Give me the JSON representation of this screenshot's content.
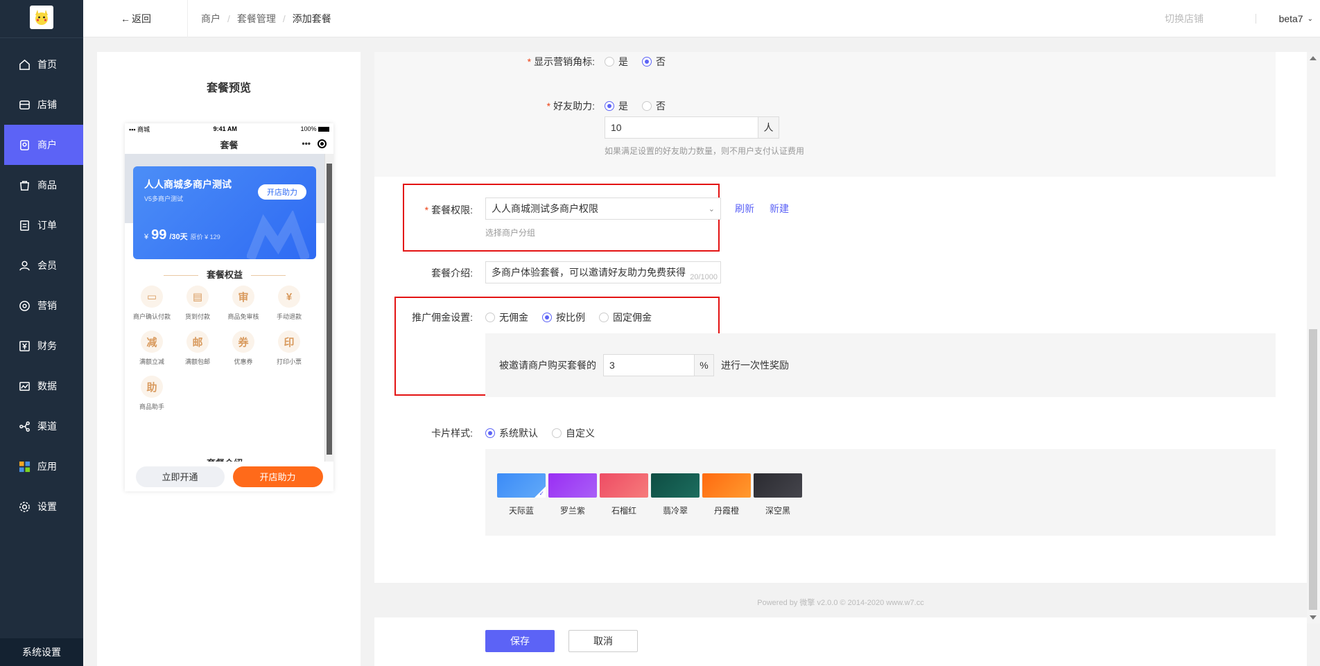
{
  "sidebar": {
    "items": [
      {
        "label": "首页",
        "icon": "home-icon"
      },
      {
        "label": "店铺",
        "icon": "store-icon"
      },
      {
        "label": "商户",
        "icon": "merchant-icon"
      },
      {
        "label": "商品",
        "icon": "goods-icon"
      },
      {
        "label": "订单",
        "icon": "order-icon"
      },
      {
        "label": "会员",
        "icon": "member-icon"
      },
      {
        "label": "营销",
        "icon": "marketing-icon"
      },
      {
        "label": "财务",
        "icon": "finance-icon"
      },
      {
        "label": "数据",
        "icon": "data-icon"
      },
      {
        "label": "渠道",
        "icon": "channel-icon"
      },
      {
        "label": "应用",
        "icon": "apps-icon"
      },
      {
        "label": "设置",
        "icon": "settings-icon"
      }
    ],
    "active_index": 2,
    "system_settings": "系统设置"
  },
  "header": {
    "back": "返回",
    "breadcrumb": [
      "商户",
      "套餐管理",
      "添加套餐"
    ],
    "switch_store": "切换店铺",
    "user": "beta7"
  },
  "preview": {
    "title": "套餐预览",
    "status": {
      "left": "商城",
      "time": "9:41 AM",
      "battery": "100%"
    },
    "nav_title": "套餐",
    "card": {
      "name": "人人商城多商户测试",
      "subtitle": "V5多商户测试",
      "button": "开店助力",
      "currency": "¥",
      "price": "99",
      "period": "/30天",
      "original": "原价 ¥ 129"
    },
    "benefits_title": "套餐权益",
    "benefits": [
      {
        "glyph": "▭",
        "label": "商户确认付款"
      },
      {
        "glyph": "▤",
        "label": "货到付款"
      },
      {
        "glyph": "审",
        "label": "商品免审核"
      },
      {
        "glyph": "¥",
        "label": "手动退款"
      },
      {
        "glyph": "减",
        "label": "满额立减"
      },
      {
        "glyph": "邮",
        "label": "满额包邮"
      },
      {
        "glyph": "券",
        "label": "优惠券"
      },
      {
        "glyph": "印",
        "label": "打印小票"
      },
      {
        "glyph": "助",
        "label": "商品助手"
      }
    ],
    "intro_title": "套餐介绍",
    "btn_open": "立即开通",
    "btn_assist": "开店助力"
  },
  "form": {
    "marketing_badge": {
      "label": "显示营销角标:",
      "options": [
        "是",
        "否"
      ],
      "selected": 1
    },
    "friend_assist": {
      "label": "好友助力:",
      "options": [
        "是",
        "否"
      ],
      "selected": 0,
      "value": "10",
      "unit": "人",
      "hint": "如果满足设置的好友助力数量，则不用户支付认证费用"
    },
    "permission": {
      "label": "套餐权限:",
      "value": "人人商城测试多商户权限",
      "refresh": "刷新",
      "new": "新建",
      "hint": "选择商户分组"
    },
    "intro": {
      "label": "套餐介绍:",
      "value": "多商户体验套餐，可以邀请好友助力免费获得",
      "count": "20/1000"
    },
    "commission": {
      "label": "推广佣金设置:",
      "options": [
        "无佣金",
        "按比例",
        "固定佣金"
      ],
      "selected": 1,
      "prefix": "被邀请商户购买套餐的",
      "value": "3",
      "unit": "%",
      "suffix": "进行一次性奖励"
    },
    "card_style": {
      "label": "卡片样式:",
      "options": [
        "系统默认",
        "自定义"
      ],
      "selected": 0,
      "swatches": [
        {
          "name": "天际蓝",
          "from": "#3b8bf7",
          "to": "#62aaf9"
        },
        {
          "name": "罗兰紫",
          "from": "#9a2ef3",
          "to": "#a95ff7"
        },
        {
          "name": "石榴红",
          "from": "#ee4c64",
          "to": "#f67b7b"
        },
        {
          "name": "翡冷翠",
          "from": "#0e4d43",
          "to": "#1c6d5e"
        },
        {
          "name": "丹霞橙",
          "from": "#ff6a10",
          "to": "#ff9a2e"
        },
        {
          "name": "深空黑",
          "from": "#2b2b31",
          "to": "#45454c"
        }
      ],
      "selected_swatch": 0
    },
    "powered": "Powered by 微擎 v2.0.0 © 2014-2020 www.w7.cc",
    "save": "保存",
    "cancel": "取消"
  },
  "colors": {
    "accent": "#5c63f6",
    "sidebar": "#1f2d3d",
    "highlight": "#e31313",
    "orange": "#ff6a1a"
  }
}
